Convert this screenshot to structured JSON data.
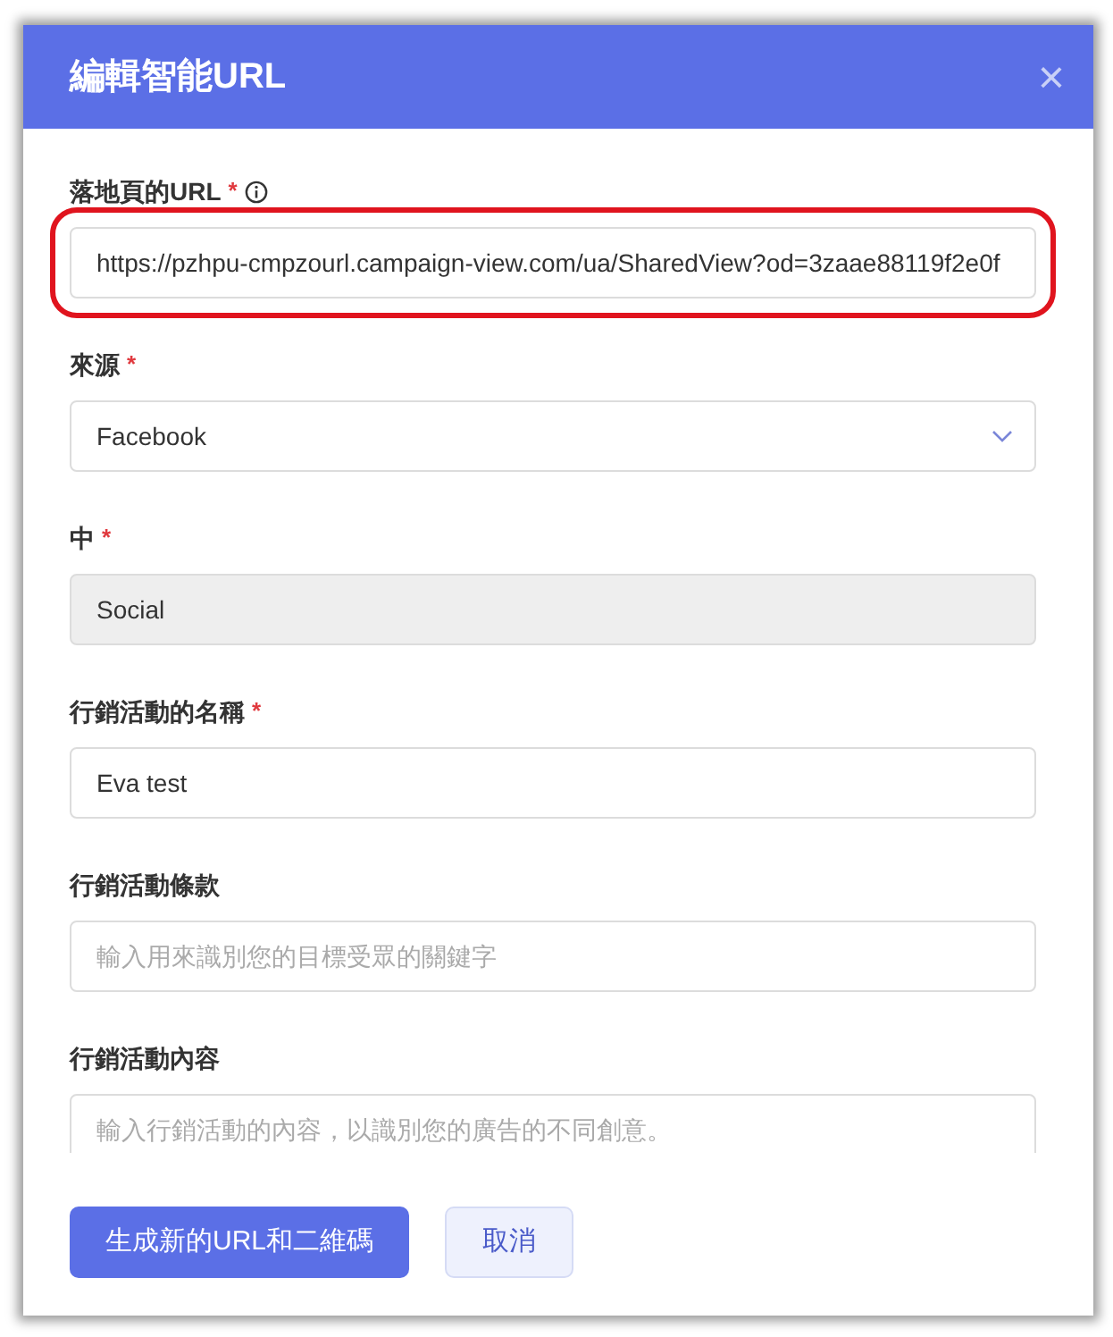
{
  "dialog": {
    "title": "編輯智能URL",
    "close": "×"
  },
  "fields": [
    {
      "kind": "text",
      "label": "落地頁的URL",
      "required_mark": "*",
      "info": true,
      "highlighted": true,
      "value": "https://pzhpu-cmpzourl.campaign-view.com/ua/SharedView?od=3zaae88119f2e0f"
    },
    {
      "kind": "select",
      "label": "來源",
      "required_mark": "*",
      "info": false,
      "highlighted": false,
      "value": "Facebook"
    },
    {
      "kind": "readonly",
      "label": "中",
      "required_mark": "*",
      "info": false,
      "highlighted": false,
      "value": "Social"
    },
    {
      "kind": "text",
      "label": "行銷活動的名稱",
      "required_mark": "*",
      "info": false,
      "highlighted": false,
      "value": "Eva test"
    },
    {
      "kind": "text",
      "label": "行銷活動條款",
      "info": false,
      "highlighted": false,
      "placeholder": "輸入用來識別您的目標受眾的關鍵字"
    },
    {
      "kind": "text",
      "label": "行銷活動內容",
      "info": false,
      "highlighted": false,
      "placeholder": "輸入行銷活動的內容，以識別您的廣告的不同創意。"
    }
  ],
  "buttons": [
    {
      "kind": "primary",
      "label": "生成新的URL和二維碼"
    },
    {
      "kind": "secondary",
      "label": "取消"
    }
  ]
}
